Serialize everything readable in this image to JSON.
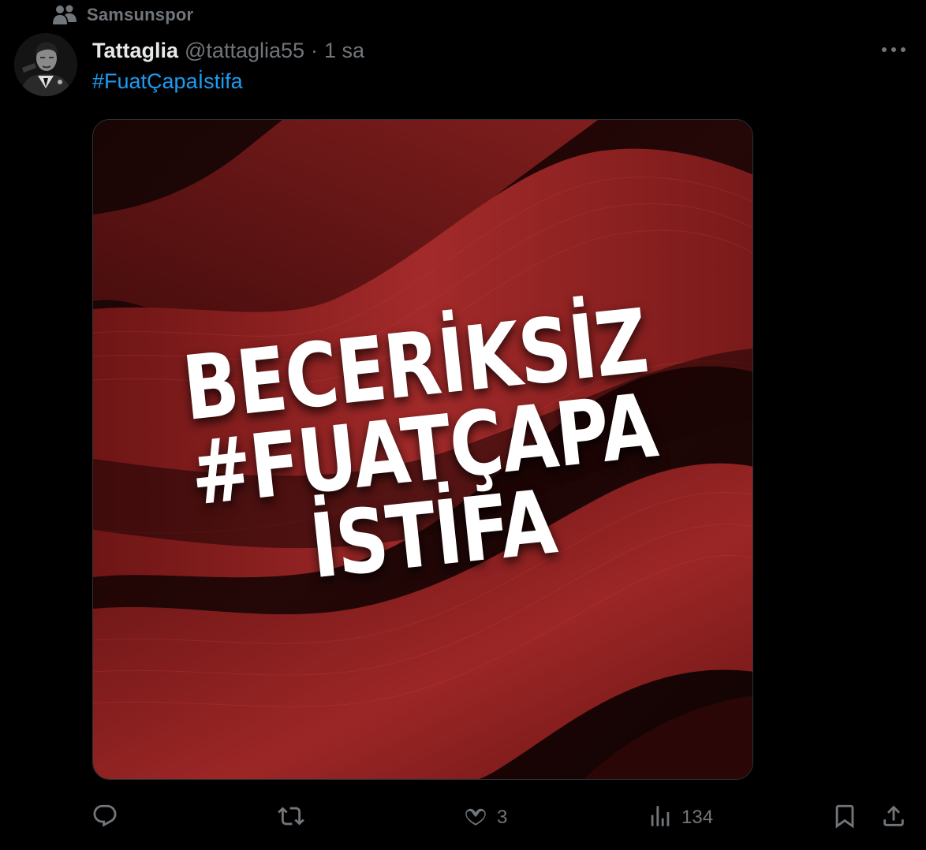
{
  "community": {
    "label": "Samsunspor",
    "icon": "community-icon"
  },
  "author": {
    "display_name": "Tattaglia",
    "handle": "@tattaglia55",
    "separator": "·",
    "time": "1 sa",
    "avatar_icon": "avatar-image"
  },
  "tweet": {
    "hashtag": "#FuatÇapaİstifa",
    "media_lines": [
      "BECERİKSİZ",
      "#FUATÇAPA",
      "İSTİFA"
    ]
  },
  "actions": {
    "reply": {
      "icon": "reply-icon",
      "count": ""
    },
    "retweet": {
      "icon": "retweet-icon",
      "count": ""
    },
    "like": {
      "icon": "heart-icon",
      "count": "3"
    },
    "views": {
      "icon": "views-icon",
      "count": "134"
    },
    "bookmark": {
      "icon": "bookmark-icon"
    },
    "share": {
      "icon": "share-icon"
    },
    "more": {
      "icon": "more-dots-icon"
    }
  },
  "colors": {
    "background": "#000000",
    "text_primary": "#e7e9ea",
    "text_secondary": "#71767b",
    "link": "#1d9bf0",
    "media_red": "#8f1e1e"
  }
}
